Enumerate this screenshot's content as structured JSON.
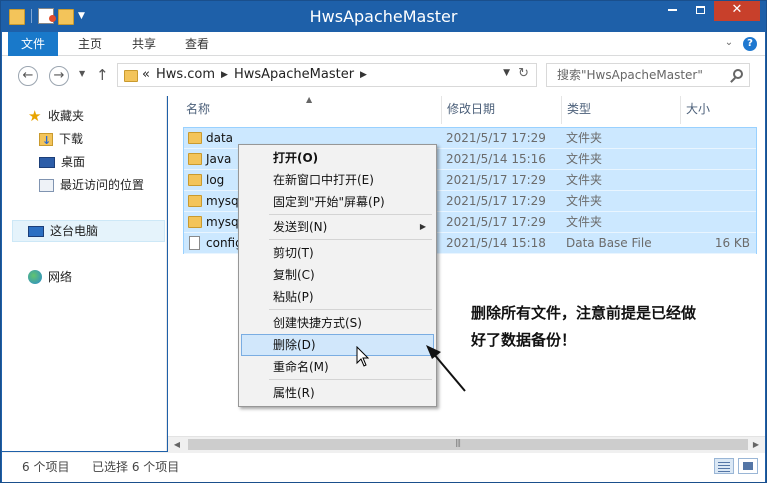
{
  "window": {
    "title": "HwsApacheMaster",
    "controls": [
      "minimize",
      "maximize",
      "close"
    ]
  },
  "ribbon": {
    "tabs": [
      "文件",
      "主页",
      "共享",
      "查看"
    ],
    "help": "?"
  },
  "address": {
    "prefix": "«",
    "crumbs": [
      "Hws.com",
      "HwsApacheMaster"
    ],
    "search_placeholder": "搜索\"HwsApacheMaster\""
  },
  "sidebar": {
    "items": [
      {
        "label": "收藏夹",
        "icon": "star-icon"
      },
      {
        "label": "下载",
        "icon": "downloads-folder-icon"
      },
      {
        "label": "桌面",
        "icon": "desktop-icon"
      },
      {
        "label": "最近访问的位置",
        "icon": "recent-places-icon"
      },
      {
        "label": "这台电脑",
        "icon": "this-pc-icon",
        "selected": true
      },
      {
        "label": "网络",
        "icon": "network-icon"
      }
    ]
  },
  "columns": [
    "名称",
    "修改日期",
    "类型",
    "大小"
  ],
  "files": [
    {
      "name": "data",
      "date": "2021/5/17 17:29",
      "type": "文件夹",
      "size": "",
      "icon": "folder-icon"
    },
    {
      "name": "Java",
      "date": "2021/5/14 15:16",
      "type": "文件夹",
      "size": "",
      "icon": "folder-icon"
    },
    {
      "name": "log",
      "date": "2021/5/17 17:29",
      "type": "文件夹",
      "size": "",
      "icon": "folder-icon"
    },
    {
      "name": "mysq",
      "date": "2021/5/17 17:29",
      "type": "文件夹",
      "size": "",
      "icon": "folder-icon"
    },
    {
      "name": "mysq",
      "date": "2021/5/17 17:29",
      "type": "文件夹",
      "size": "",
      "icon": "folder-icon"
    },
    {
      "name": "config",
      "date": "2021/5/14 15:18",
      "type": "Data Base File",
      "size": "16 KB",
      "icon": "database-file-icon"
    }
  ],
  "context_menu": {
    "items": [
      {
        "label": "打开(O)",
        "bold": true
      },
      {
        "label": "在新窗口中打开(E)"
      },
      {
        "label": "固定到\"开始\"屏幕(P)"
      },
      {
        "label": "发送到(N)",
        "submenu": true
      },
      {
        "label": "剪切(T)"
      },
      {
        "label": "复制(C)"
      },
      {
        "label": "粘贴(P)"
      },
      {
        "label": "创建快捷方式(S)"
      },
      {
        "label": "删除(D)",
        "highlighted": true
      },
      {
        "label": "重命名(M)"
      },
      {
        "label": "属性(R)"
      }
    ]
  },
  "status": {
    "count": "6 个项目",
    "selected": "已选择 6 个项目"
  },
  "annotation": {
    "line1": "删除所有文件，注意前提是已经做",
    "line2": "好了数据备份！"
  },
  "colors": {
    "titlebar": "#1e60a9",
    "file_tab": "#1979ca",
    "selection": "#cce8ff",
    "menu_highlight": "#d1e7fb",
    "close_button": "#c8402b"
  }
}
